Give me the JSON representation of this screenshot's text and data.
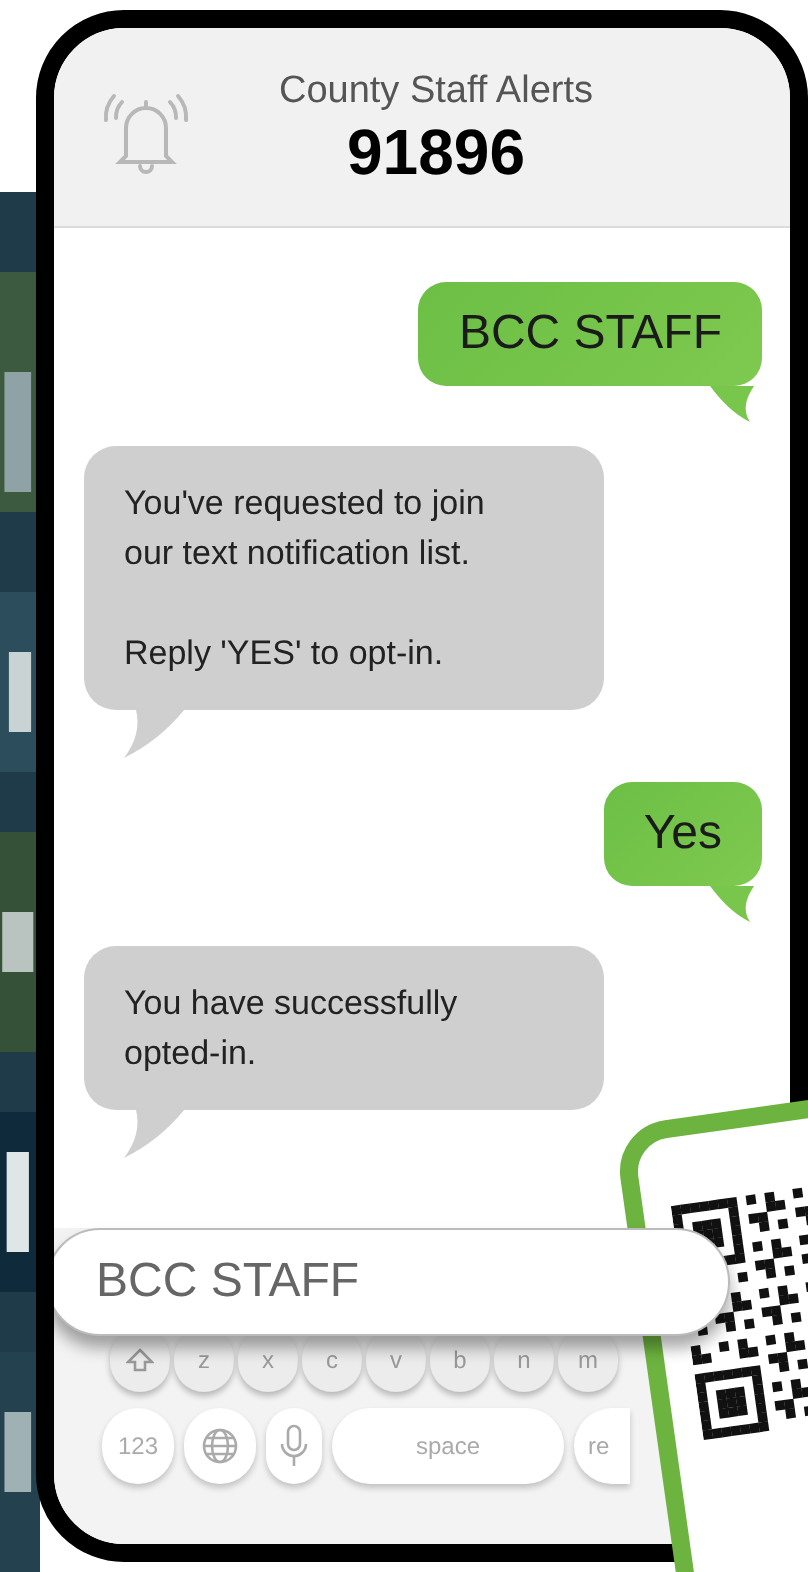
{
  "header": {
    "title": "County Staff Alerts",
    "number": "91896"
  },
  "messages": [
    {
      "kind": "sent",
      "paragraphs": [
        "BCC STAFF"
      ]
    },
    {
      "kind": "received",
      "paragraphs": [
        "You've requested to join our text notification list.",
        "Reply 'YES' to opt-in."
      ]
    },
    {
      "kind": "sent",
      "paragraphs": [
        "Yes"
      ]
    },
    {
      "kind": "received",
      "paragraphs": [
        "You have successfully opted-in."
      ]
    }
  ],
  "input": {
    "value": "BCC STAFF"
  },
  "keyboard": {
    "letter_row": [
      {
        "kind": "shift"
      },
      {
        "kind": "letter",
        "label": "z"
      },
      {
        "kind": "letter",
        "label": "x"
      },
      {
        "kind": "letter",
        "label": "c"
      },
      {
        "kind": "letter",
        "label": "v"
      },
      {
        "kind": "letter",
        "label": "b"
      },
      {
        "kind": "letter",
        "label": "n"
      },
      {
        "kind": "letter",
        "label": "m"
      }
    ],
    "bottom_row": [
      {
        "kind": "text",
        "label": "123"
      },
      {
        "kind": "globe"
      },
      {
        "kind": "mic"
      },
      {
        "kind": "space",
        "label": "space"
      },
      {
        "kind": "return",
        "label": "re"
      }
    ]
  }
}
